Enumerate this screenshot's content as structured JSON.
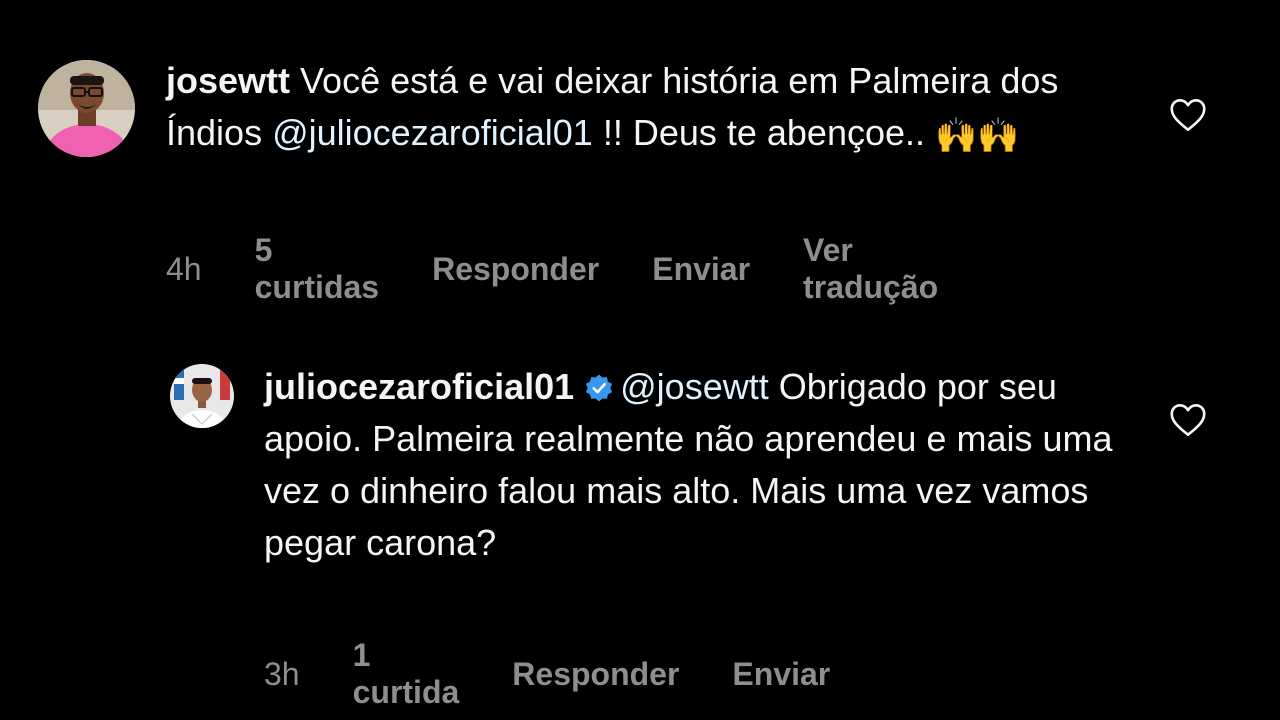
{
  "comments": [
    {
      "username": "josewtt",
      "text_before": "Você está e vai deixar história em Palmeira dos Índios",
      "mention": "@juliocezaroficial01",
      "text_after": "!! Deus te abençoe..",
      "emoji": "🙌🙌",
      "time": "4h",
      "likes": "5 curtidas",
      "reply_label": "Responder",
      "send_label": "Enviar",
      "translate_label": "Ver tradução",
      "like_icon": "heart-outline-icon"
    },
    {
      "username": "juliocezaroficial01",
      "verified_icon": "verified-badge-icon",
      "mention": "@josewtt",
      "text_after": "Obrigado por seu apoio. Palmeira realmente não aprendeu e mais uma vez o dinheiro falou mais alto. Mais uma vez vamos pegar carona?",
      "time": "3h",
      "likes": "1 curtida",
      "reply_label": "Responder",
      "send_label": "Enviar",
      "like_icon": "heart-outline-icon"
    }
  ],
  "colors": {
    "background": "#000000",
    "text": "#f5f5f5",
    "mention": "#e0f1ff",
    "meta": "#8e8e8e",
    "verified": "#3897f0"
  }
}
